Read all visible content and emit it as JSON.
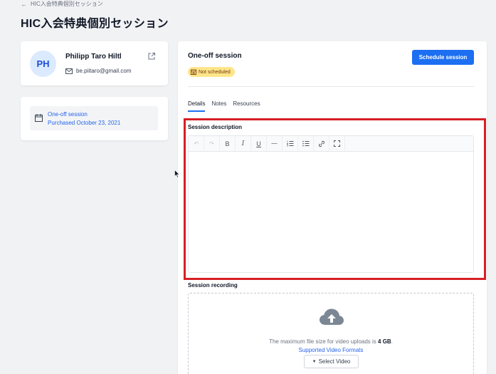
{
  "breadcrumb": {
    "back_label": "HIC入会特典個別セッション"
  },
  "page": {
    "title": "HIC入会特典個別セッション"
  },
  "user": {
    "initials": "PH",
    "name": "Philipp Taro Hiltl",
    "email": "be.piitaro@gmail.com"
  },
  "purchase": {
    "title": "One-off session",
    "date": "Purchased October 23, 2021"
  },
  "session": {
    "title": "One-off session",
    "status": "Not scheduled",
    "schedule_button": "Schedule session",
    "tabs": [
      "Details",
      "Notes",
      "Resources"
    ],
    "active_tab": "Details",
    "description_label": "Session description",
    "toolbar": [
      "undo-icon",
      "redo-icon",
      "bold-icon",
      "italic-icon",
      "underline-icon",
      "horizontal-rule-icon",
      "ordered-list-icon",
      "bullet-list-icon",
      "link-icon",
      "fullscreen-icon"
    ],
    "recording_label": "Session recording",
    "upload": {
      "limit_prefix": "The maximum file size for video uploads is ",
      "limit_value": "4 GB",
      "limit_suffix": ".",
      "formats_link": "Supported Video Formats",
      "select_button": "Select Video"
    }
  },
  "colors": {
    "accent": "#1d6ff2",
    "status_badge": "#fde68a",
    "highlight": "#d61f26",
    "avatar_bg": "#dbeafe"
  }
}
